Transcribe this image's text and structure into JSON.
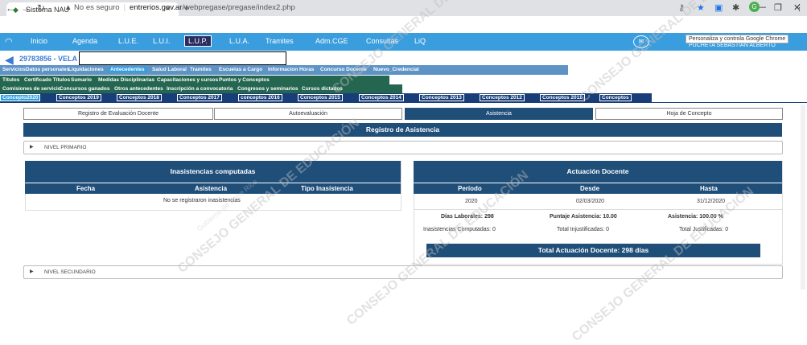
{
  "browser": {
    "tab_title": "Sistema NAU",
    "url_warning": "No es seguro",
    "url_host": "entrerios.gov.ar",
    "url_path": "/webpregase/pregase/index2.php",
    "tooltip": "Personaliza y controla Google Chrome"
  },
  "app_nav": {
    "items": [
      "Inicio",
      "Agenda",
      "L.U.E.",
      "L.U.I.",
      "L.U.P.",
      "L.U.A.",
      "Tramites",
      "Adm.CGE",
      "Consultas",
      "LiQ"
    ],
    "active": "L.U.P.",
    "right_text": "PUCHETA SEBASTIAN ALBERTO"
  },
  "user": {
    "id": "29783856 - VELA"
  },
  "tabs_row1": [
    "Servicios",
    "Datos personales",
    "Liquidaciones",
    "Antecedentes",
    "Salud Laboral",
    "Tramites",
    "Escuelas a Cargo",
    "Informacion Horas",
    "Concurso Docente",
    "Nuevo_Credencial"
  ],
  "tabs_row1_active": "Antecedentes",
  "tabs_row2": [
    "Títulos",
    "Certificado Títulos",
    "Sumario",
    "Medidas Disciplinarias",
    "Capacitaciones y cursos",
    "Puntos y Conceptos"
  ],
  "tabs_row3": [
    "Comisiones de servicio",
    "Concursos ganados",
    "Otros antecedentes",
    "Inscripción a convocatoria",
    "Congresos y seminarios",
    "Cursos dictados"
  ],
  "tabs_row4": [
    "Concepto2020",
    "Conceptos 2019",
    "Conceptos 2018",
    "Conceptos 2017",
    "conceptos 2016",
    "Conceptos 2015",
    "Conceptos 2014",
    "Conceptos 2013",
    "Conceptos 2012",
    "Conceptos 2011",
    "Conceptos"
  ],
  "subtabs": [
    "Registro de Evaluación Docente",
    "Autoevaluación",
    "Asistencia",
    "Hoja de Concepto"
  ],
  "subtabs_active": "Asistencia",
  "registro_title": "Registro de Asistencia",
  "nivel_primario": "NIVEL PRIMARIO",
  "nivel_secundario": "NIVEL SECUNDARIO",
  "inasistencias": {
    "title": "Inasistencias computadas",
    "columns": [
      "Fecha",
      "Asistencia",
      "Tipo Inasistencia"
    ],
    "empty": "No se registraron inasistencias"
  },
  "actuacion": {
    "title": "Actuación Docente",
    "columns": [
      "Período",
      "Desde",
      "Hasta"
    ],
    "row": [
      "2020",
      "02/03/2020",
      "31/12/2020"
    ],
    "stats": [
      "Días Laborales: 298",
      "Puntaje Asistencia: 10.00",
      "Asistencia: 100.00 %",
      "Inasistencias Computadas: 0",
      "Total Injustificadas: 0",
      "Total Justificadas: 0"
    ],
    "total": "Total Actuación Docente: 298 días"
  },
  "watermarks": [
    "CONSEJO GENERAL DE EDUCACIÓN",
    "Gobierno de Entre Ríos"
  ]
}
